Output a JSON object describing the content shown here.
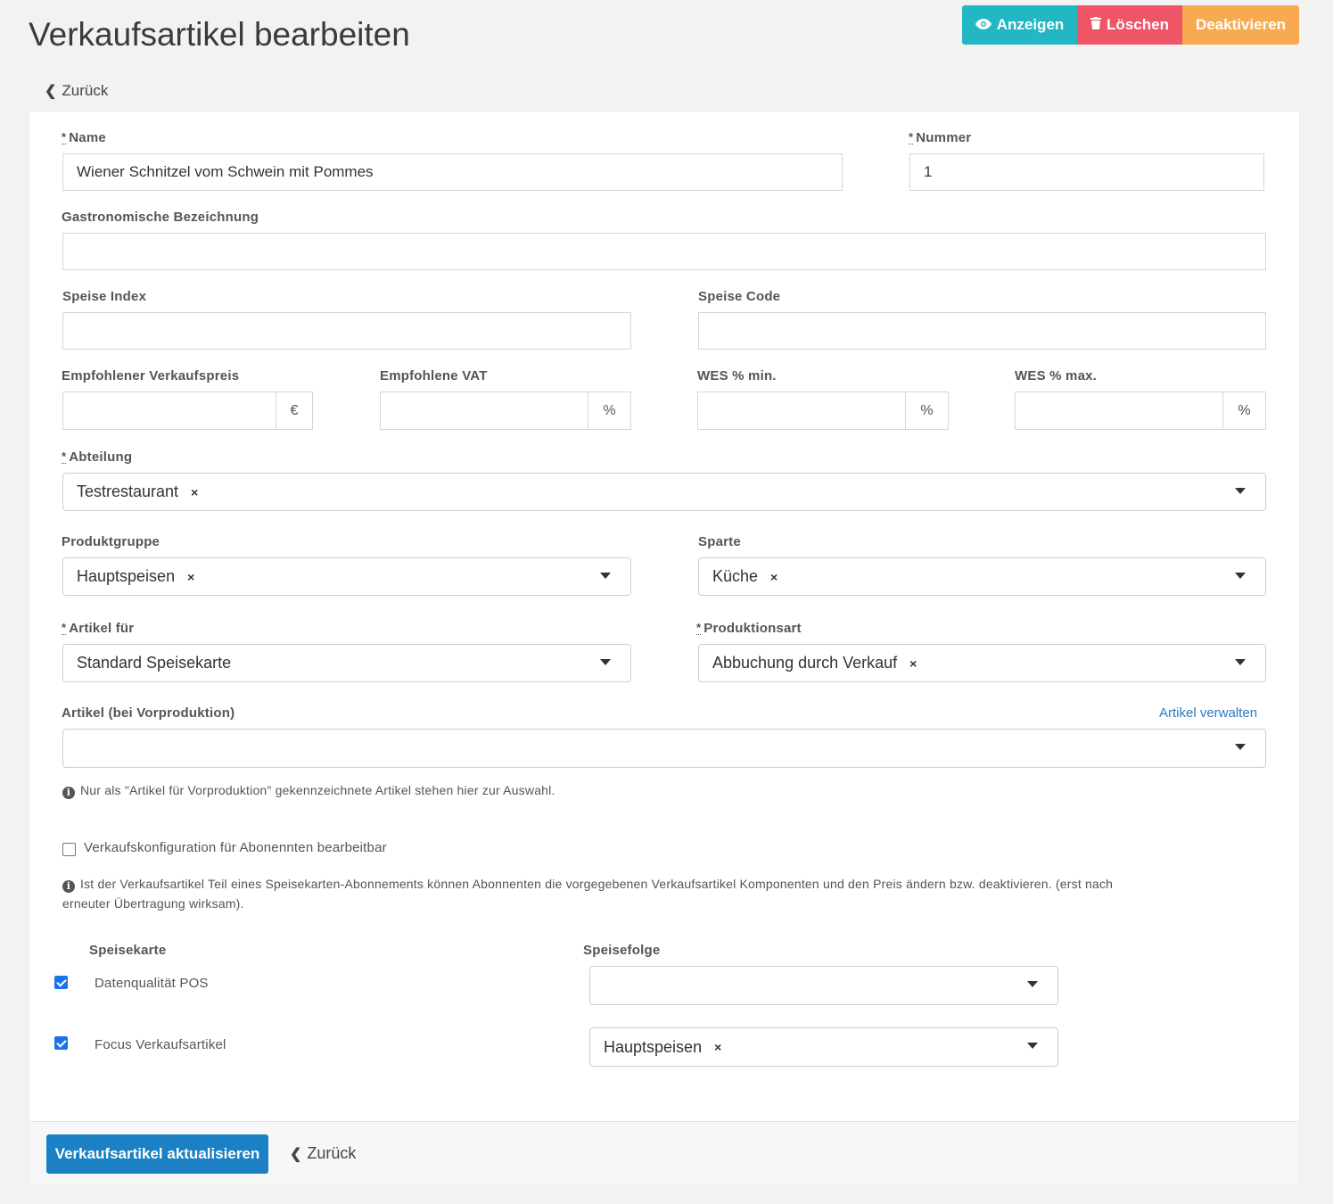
{
  "page": {
    "title": "Verkaufsartikel bearbeiten",
    "back_label": "Zurück"
  },
  "actions": {
    "show_label": "Anzeigen",
    "delete_label": "Löschen",
    "deactivate_label": "Deaktivieren"
  },
  "form": {
    "name": {
      "label": "Name",
      "value": "Wiener Schnitzel vom Schwein mit Pommes"
    },
    "number": {
      "label": "Nummer",
      "value": "1"
    },
    "gastro_name": {
      "label": "Gastronomische Bezeichnung",
      "value": ""
    },
    "speise_index": {
      "label": "Speise Index",
      "value": ""
    },
    "speise_code": {
      "label": "Speise Code",
      "value": ""
    },
    "recommended_price": {
      "label": "Empfohlener Verkaufspreis",
      "value": "",
      "unit": "€"
    },
    "recommended_vat": {
      "label": "Empfohlene VAT",
      "value": "",
      "unit": "%"
    },
    "wes_min": {
      "label": "WES % min.",
      "value": "",
      "unit": "%"
    },
    "wes_max": {
      "label": "WES % max.",
      "value": "",
      "unit": "%"
    },
    "department": {
      "label": "Abteilung",
      "value": "Testrestaurant",
      "remove": "×"
    },
    "product_group": {
      "label": "Produktgruppe",
      "value": "Hauptspeisen",
      "remove": "×"
    },
    "division": {
      "label": "Sparte",
      "value": "Küche",
      "remove": "×"
    },
    "article_for": {
      "label": "Artikel für",
      "value": "Standard Speisekarte"
    },
    "production_type": {
      "label": "Produktionsart",
      "value": "Abbuchung durch Verkauf",
      "remove": "×"
    },
    "preproduction_article": {
      "label": "Artikel (bei Vorproduktion)",
      "value": "",
      "manage_link": "Artikel verwalten",
      "help": "Nur als \"Artikel für Vorproduktion\" gekennzeichnete Artikel stehen hier zur Auswahl."
    },
    "subscriber_config": {
      "label": "Verkaufskonfiguration für Abonennten bearbeitbar",
      "checked": false,
      "help_line1": "Ist der Verkaufsartikel Teil eines Speisekarten-Abonnements können Abonnenten die vorgegebenen Verkaufsartikel Komponenten und den Preis ändern bzw. deaktivieren. (erst nach",
      "help_line2": "erneuter Übertragung wirksam)."
    }
  },
  "menus": {
    "col_menu": "Speisekarte",
    "col_course": "Speisefolge",
    "rows": [
      {
        "name": "Datenqualität POS",
        "checked": true,
        "course": ""
      },
      {
        "name": "Focus Verkaufsartikel",
        "checked": true,
        "course": "Hauptspeisen",
        "remove": "×"
      }
    ]
  },
  "footer": {
    "submit_label": "Verkaufsartikel aktualisieren",
    "back_label": "Zurück"
  },
  "colors": {
    "info": "#23b7c4",
    "danger": "#ee5566",
    "warning": "#f8aa50",
    "primary": "#1b80c4",
    "link": "#2b7bc0"
  }
}
